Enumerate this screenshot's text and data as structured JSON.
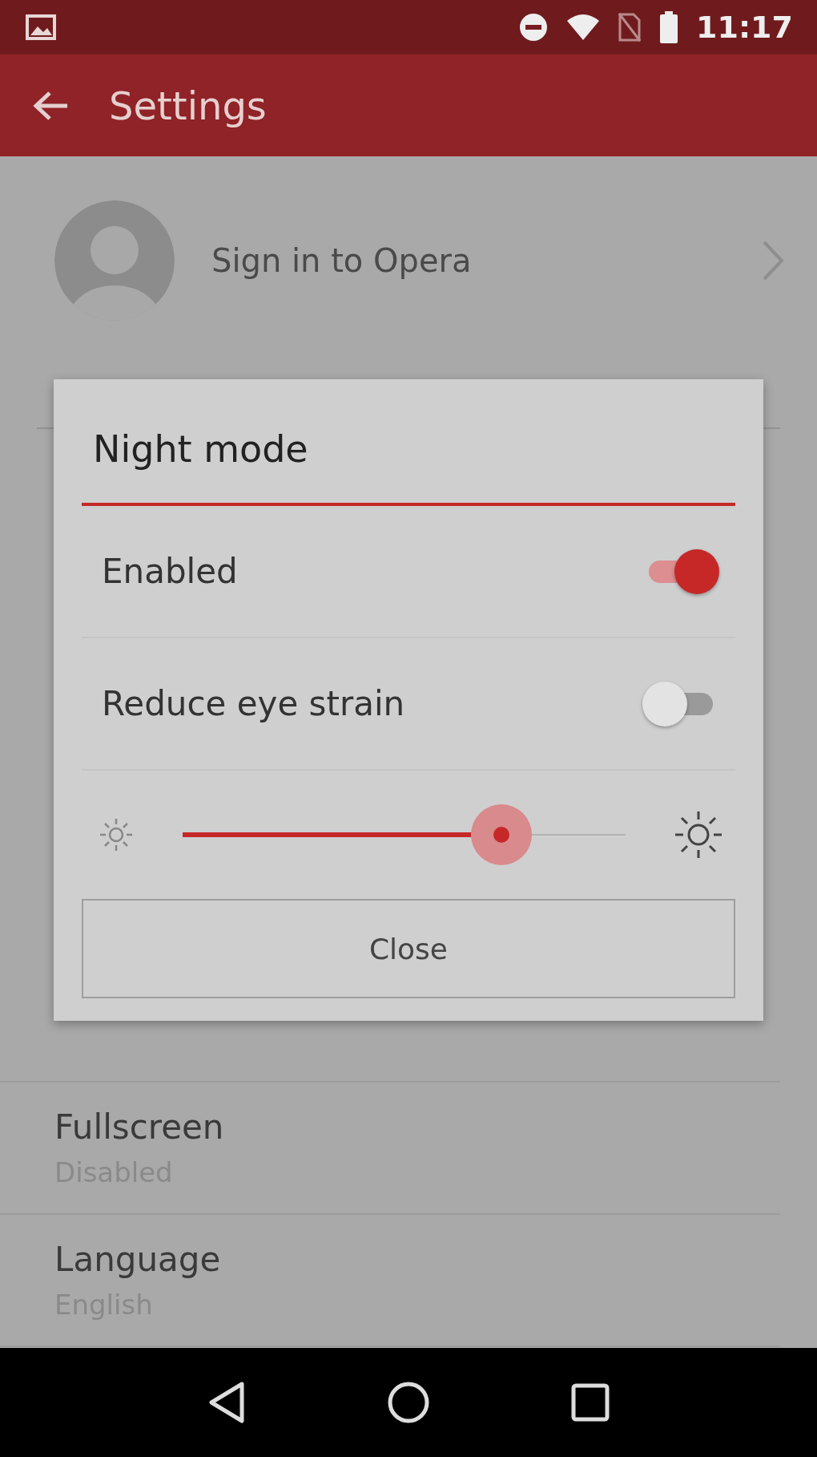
{
  "status_bar": {
    "time": "11:17"
  },
  "app_bar": {
    "title": "Settings"
  },
  "account": {
    "label": "Sign in to Opera"
  },
  "settings": [
    {
      "title": "Fullscreen",
      "subtitle": "Disabled"
    },
    {
      "title": "Language",
      "subtitle": "English"
    }
  ],
  "dialog": {
    "title": "Night mode",
    "options": [
      {
        "label": "Enabled",
        "on": true
      },
      {
        "label": "Reduce eye strain",
        "on": false
      }
    ],
    "brightness": {
      "level": 0.72
    },
    "close_button": "Close"
  }
}
